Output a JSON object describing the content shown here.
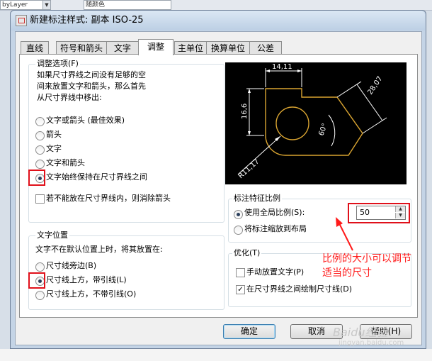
{
  "background_toolbar": {
    "layer_combo": "byLayer",
    "color_combo": "随颜色"
  },
  "window": {
    "title": "新建标注样式: 副本 ISO-25"
  },
  "tabs": [
    {
      "label": "直线",
      "active": false
    },
    {
      "label": "符号和箭头",
      "active": false
    },
    {
      "label": "文字",
      "active": false
    },
    {
      "label": "调整",
      "active": true
    },
    {
      "label": "主单位",
      "active": false
    },
    {
      "label": "换算单位",
      "active": false
    },
    {
      "label": "公差",
      "active": false
    }
  ],
  "fit_options": {
    "title": "调整选项(F)",
    "description": [
      "如果尺寸界线之间没有足够的空",
      "间来放置文字和箭头，那么首先",
      "从尺寸界线中移出:"
    ],
    "radios": [
      {
        "label": "文字或箭头 (最佳效果)",
        "checked": false
      },
      {
        "label": "箭头",
        "checked": false
      },
      {
        "label": "文字",
        "checked": false
      },
      {
        "label": "文字和箭头",
        "checked": false
      },
      {
        "label": "文字始终保持在尺寸界线之间",
        "checked": true
      }
    ],
    "suppress_checkbox": {
      "label": "若不能放在尺寸界线内，则消除箭头",
      "checked": false
    }
  },
  "text_placement": {
    "title": "文字位置",
    "description": "文字不在默认位置上时，将其放置在:",
    "radios": [
      {
        "label": "尺寸线旁边(B)",
        "checked": false
      },
      {
        "label": "尺寸线上方，带引线(L)",
        "checked": true
      },
      {
        "label": "尺寸线上方，不带引线(O)",
        "checked": false
      }
    ]
  },
  "preview": {
    "dims": [
      "14,11",
      "16,6",
      "28,07",
      "60°",
      "R11,17"
    ]
  },
  "scale_features": {
    "title": "标注特征比例",
    "use_overall_label": "使用全局比例(S):",
    "use_overall_checked": true,
    "overall_scale_value": "50",
    "scale_to_layout_label": "将标注缩放到布局",
    "scale_to_layout_checked": false
  },
  "fine_tuning": {
    "title": "优化(T)",
    "checkboxes": [
      {
        "label": "手动放置文字(P)",
        "checked": false
      },
      {
        "label": "在尺寸界线之间绘制尺寸线(D)",
        "checked": true
      }
    ]
  },
  "annotation": {
    "line1": "比例的大小可以调节",
    "line2": "适当的尺寸"
  },
  "buttons": {
    "ok": "确定",
    "cancel": "取消",
    "help": "帮助(H)"
  },
  "watermark": {
    "brand": "Baidu经验",
    "url": "jingyan.baidu.com"
  },
  "colors": {
    "highlight_red": "#e0101a",
    "annotation_red": "#ff1a1a",
    "preview_bg": "#000000",
    "preview_shape": "#d9a431"
  }
}
